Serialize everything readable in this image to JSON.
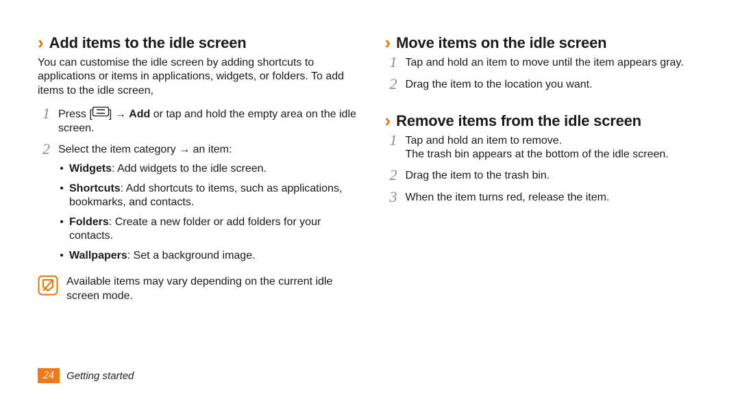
{
  "left": {
    "h_add": "Add items to the idle screen",
    "intro": "You can customise the idle screen by adding shortcuts to applications or items in applications, widgets, or folders. To add items to the idle screen,",
    "step1_a": "Press [",
    "step1_b": "] → ",
    "step1_add": "Add",
    "step1_c": " or tap and hold the empty area on the idle screen.",
    "step2": "Select the item category → an item:",
    "b_widgets_l": "Widgets",
    "b_widgets_t": ": Add widgets to the idle screen.",
    "b_shortcuts_l": "Shortcuts",
    "b_shortcuts_t": ": Add shortcuts to items, such as applications, bookmarks, and contacts.",
    "b_folders_l": "Folders",
    "b_folders_t": ": Create a new folder or add folders for your contacts.",
    "b_wall_l": "Wallpapers",
    "b_wall_t": ": Set a background image.",
    "note": "Available items may vary depending on the current idle screen mode."
  },
  "right": {
    "h_move": "Move items on the idle screen",
    "move1": "Tap and hold an item to move until the item appears gray.",
    "move2": "Drag the item to the location you want.",
    "h_remove": "Remove items from the idle screen",
    "rem1a": "Tap and hold an item to remove.",
    "rem1b": "The trash bin appears at the bottom of the idle screen.",
    "rem2": "Drag the item to the trash bin.",
    "rem3": "When the item turns red, release the item."
  },
  "footer": {
    "page": "24",
    "chapter": "Getting started"
  },
  "nums": {
    "n1": "1",
    "n2": "2",
    "n3": "3"
  },
  "bullet": "•"
}
